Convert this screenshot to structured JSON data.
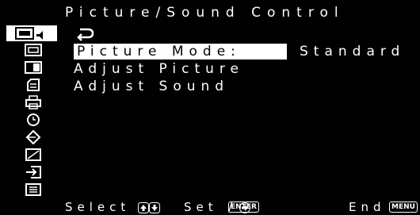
{
  "window": {
    "title": "Picture/Sound Control"
  },
  "sidebar": {
    "items": [
      {
        "icon": "picture-sound-icon",
        "active": true
      },
      {
        "icon": "screen-icon",
        "active": false
      },
      {
        "icon": "pip-icon",
        "active": false
      },
      {
        "icon": "setup-icon",
        "active": false
      },
      {
        "icon": "printer-icon",
        "active": false
      },
      {
        "icon": "timer-icon",
        "active": false
      },
      {
        "icon": "input-output-icon",
        "active": false
      },
      {
        "icon": "adjust-icon",
        "active": false
      },
      {
        "icon": "input-select-icon",
        "active": false
      },
      {
        "icon": "menu-list-icon",
        "active": false
      }
    ]
  },
  "menu": {
    "back_icon": "return-arrow-icon",
    "items": [
      {
        "label": "Picture Mode:",
        "value": "Standard"
      },
      {
        "label": "Adjust Picture"
      },
      {
        "label": "Adjust Sound"
      }
    ]
  },
  "footer": {
    "select_label": "Select",
    "set_label": "Set",
    "enter_key": "ENTER",
    "slash": "/",
    "end_label": "End",
    "menu_key": "MENU"
  }
}
